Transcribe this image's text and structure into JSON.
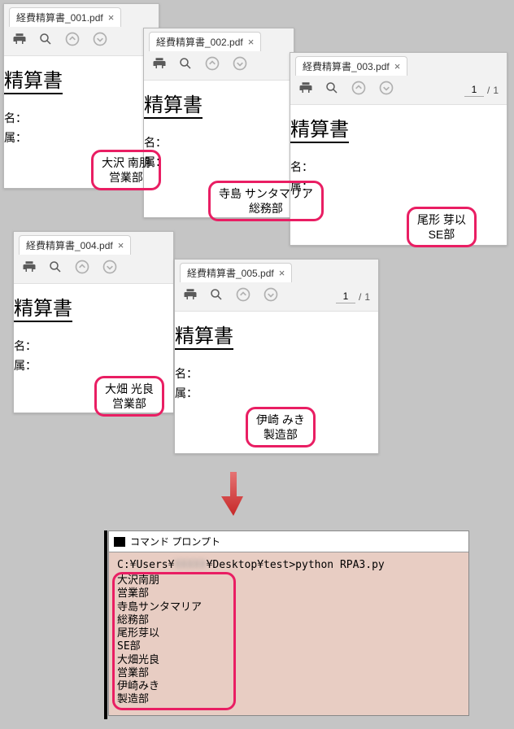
{
  "windows": [
    {
      "id": "w1",
      "tab_title": "経費精算書_001.pdf",
      "doc_title": "精算書",
      "label_name": "名：",
      "label_dept": "属：",
      "highlight_name": "大沢 南朋",
      "highlight_dept": "営業部"
    },
    {
      "id": "w2",
      "tab_title": "経費精算書_002.pdf",
      "doc_title": "精算書",
      "label_name": "名：",
      "label_dept": "属：",
      "highlight_name": "寺島 サンタマリア",
      "highlight_dept": "総務部"
    },
    {
      "id": "w3",
      "tab_title": "経費精算書_003.pdf",
      "doc_title": "精算書",
      "label_name": "名：",
      "label_dept": "属：",
      "highlight_name": "尾形 芽以",
      "highlight_dept": "SE部",
      "page_current": "1",
      "page_total": "1"
    },
    {
      "id": "w4",
      "tab_title": "経費精算書_004.pdf",
      "doc_title": "精算書",
      "label_name": "名：",
      "label_dept": "属：",
      "highlight_name": "大畑 光良",
      "highlight_dept": "営業部"
    },
    {
      "id": "w5",
      "tab_title": "経費精算書_005.pdf",
      "doc_title": "精算書",
      "label_name": "名：",
      "label_dept": "属：",
      "highlight_name": "伊崎 みき",
      "highlight_dept": "製造部",
      "page_current": "1",
      "page_total": "1"
    }
  ],
  "cmd": {
    "title": "コマンド プロンプト",
    "prompt_pre": "C:¥Users¥",
    "prompt_post": "¥Desktop¥test>python RPA3.py",
    "output": [
      "大沢南朋",
      "営業部",
      "寺島サンタマリア",
      "総務部",
      "尾形芽以",
      "SE部",
      "大畑光良",
      "営業部",
      "伊崎みき",
      "製造部"
    ]
  },
  "icons": {
    "print": "print-icon",
    "zoom": "zoom-icon",
    "up": "arrow-up-icon",
    "down": "arrow-down-icon",
    "close": "close-icon"
  }
}
